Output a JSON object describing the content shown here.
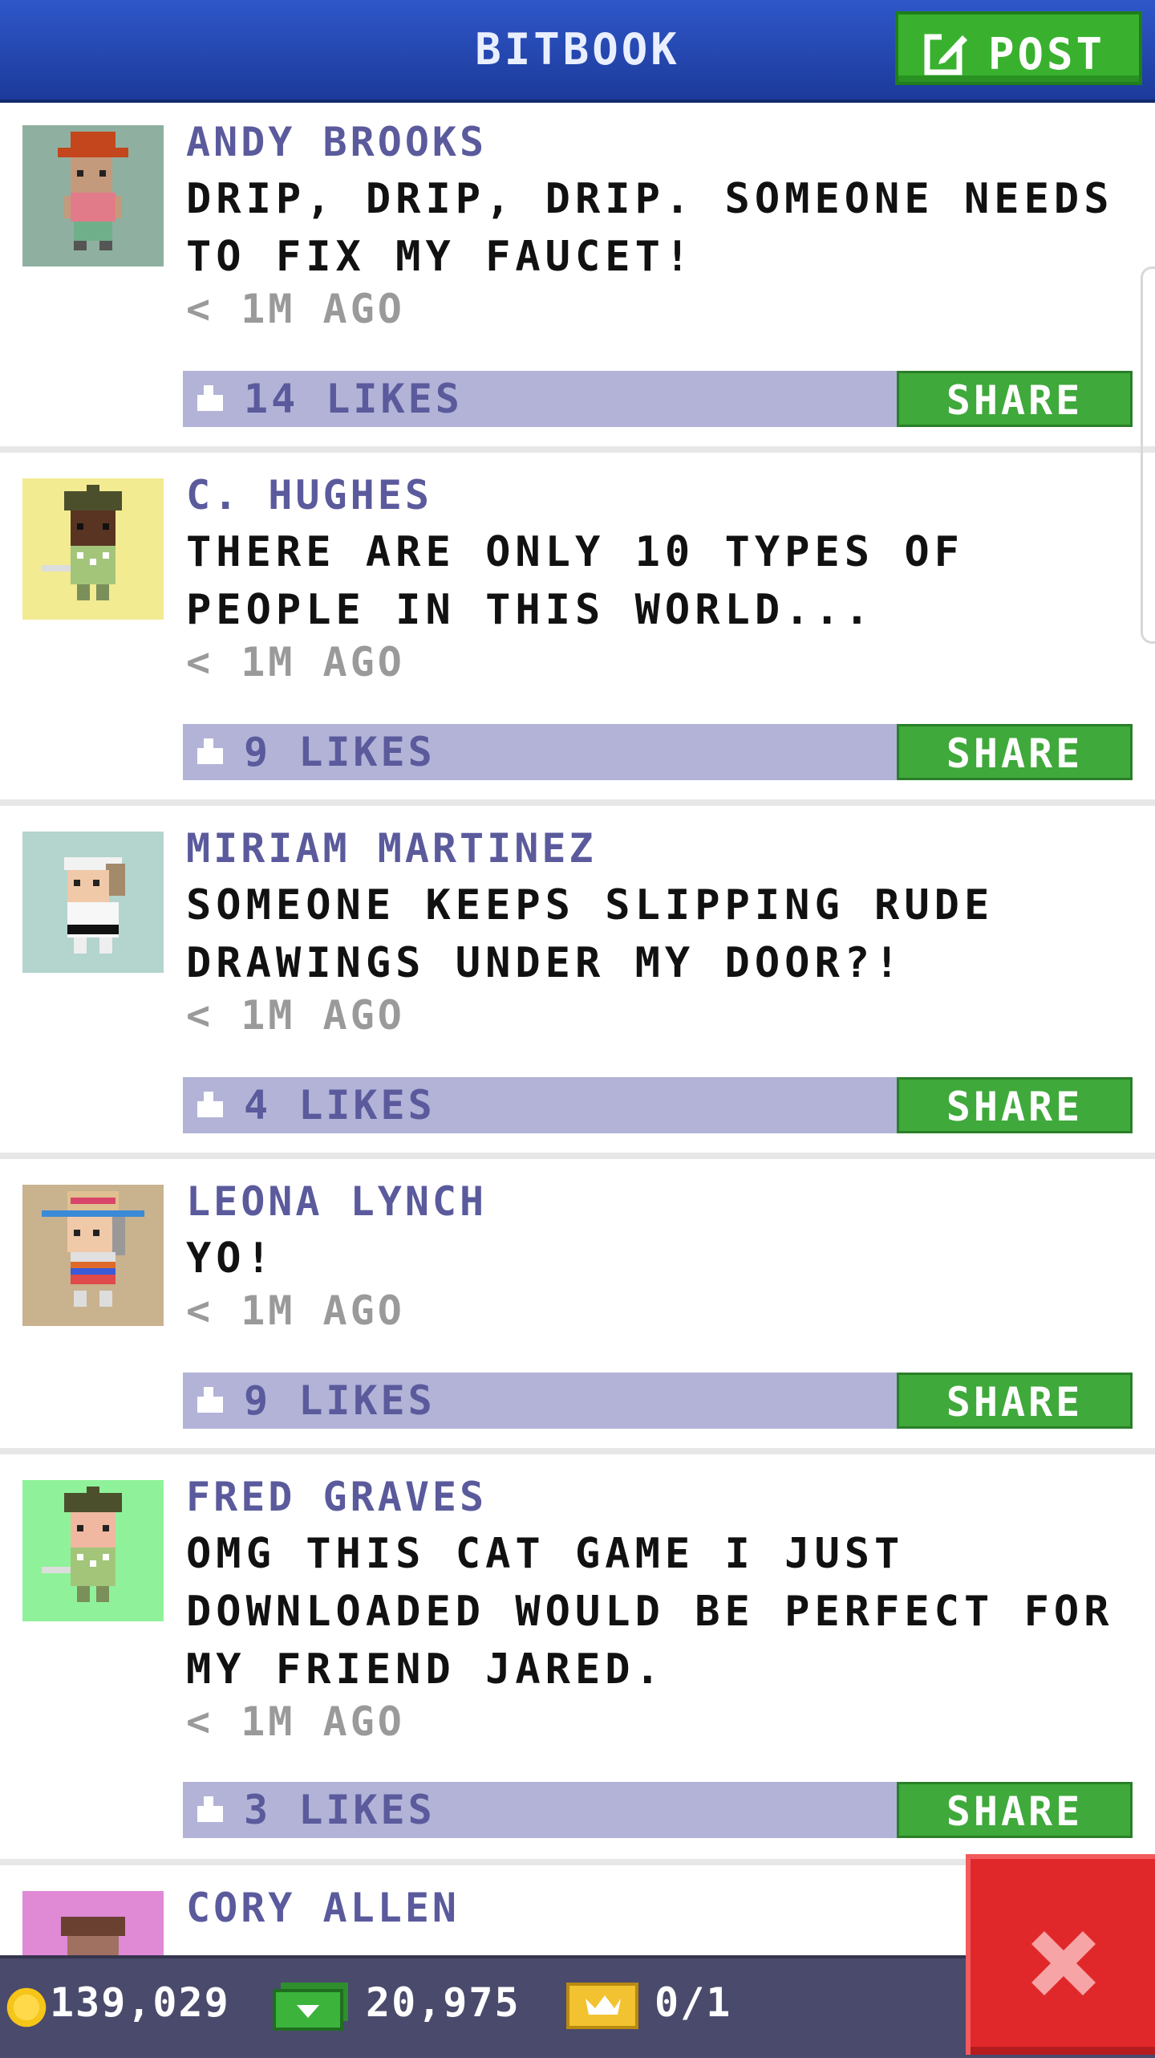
{
  "header": {
    "title": "BITBOOK",
    "post_label": "POST",
    "post_icon": "compose-icon"
  },
  "posts": [
    {
      "author": "ANDY BROOKS",
      "message": "DRIP, DRIP, DRIP. SOMEONE NEEDS TO FIX MY FAUCET!",
      "time": "< 1M AGO",
      "likes": "14 LIKES",
      "share_label": "SHARE",
      "avatar_bg": "#8fb0a0"
    },
    {
      "author": "C. HUGHES",
      "message": "THERE ARE ONLY 10 TYPES OF PEOPLE IN THIS WORLD...",
      "time": "< 1M AGO",
      "likes": "9 LIKES",
      "share_label": "SHARE",
      "avatar_bg": "#f2eb92"
    },
    {
      "author": "MIRIAM MARTINEZ",
      "message": "SOMEONE KEEPS SLIPPING RUDE DRAWINGS UNDER MY DOOR?!",
      "time": "< 1M AGO",
      "likes": "4 LIKES",
      "share_label": "SHARE",
      "avatar_bg": "#b4d4ce"
    },
    {
      "author": "LEONA LYNCH",
      "message": "YO!",
      "time": "< 1M AGO",
      "likes": "9 LIKES",
      "share_label": "SHARE",
      "avatar_bg": "#c9b28e"
    },
    {
      "author": "FRED GRAVES",
      "message": "OMG THIS CAT GAME I JUST DOWNLOADED WOULD BE PERFECT FOR MY FRIEND JARED.",
      "time": "< 1M AGO",
      "likes": "3 LIKES",
      "share_label": "SHARE",
      "avatar_bg": "#8ff29a"
    },
    {
      "author": "CORY ALLEN",
      "avatar_bg": "#e08ad6"
    }
  ],
  "currency": {
    "coins": "139,029",
    "bux": "20,975",
    "tickets": "0/1"
  },
  "colors": {
    "header": "#1f42a8",
    "post_button": "#39b12e",
    "likes_bar": "#b2b3d7",
    "share": "#3fa93b",
    "close": "#e0282b",
    "bottom_bar": "#4a4a6c"
  }
}
